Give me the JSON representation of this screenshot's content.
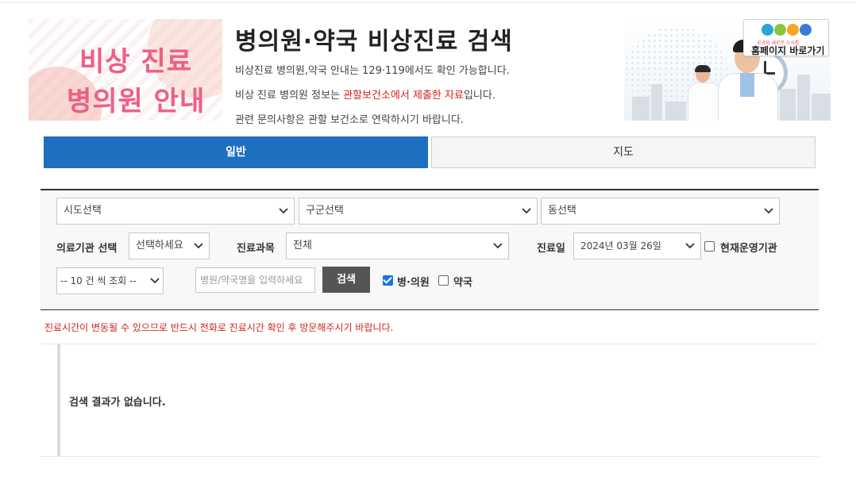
{
  "header": {
    "banner_left": {
      "line1": "비상 진료",
      "line2": "병의원 안내"
    },
    "title": "병의원·약국 비상진료 검색",
    "info1": "비상진료 병의원,약국 안내는 129·119에서도 확인 가능합니다.",
    "info2_pre": "비상 진료 병의원 정보는 ",
    "info2_red": "관할보건소에서 제출한 자료",
    "info2_post": "입니다.",
    "info3": "관련 문의사항은 관할 보건소로 연락하시기 바랍니다.",
    "home_button": {
      "tagline": "공공의 새로운 소식통",
      "label": "홈페이지 바로가기"
    }
  },
  "tabs": [
    {
      "label": "일반",
      "active": true
    },
    {
      "label": "지도",
      "active": false
    }
  ],
  "search": {
    "sido": "시도선택",
    "gugun": "구군선택",
    "dong": "동선택",
    "institution_label": "의료기관 선택",
    "institution_value": "선택하세요",
    "subject_label": "진료과목",
    "subject_value": "전체",
    "date_label": "진료일",
    "date_value": "2024년 03월 26일",
    "open_now_label": "현재운영기관",
    "open_now_checked": false,
    "page_size": "-- 10 건 씩 조회 --",
    "name_placeholder": "병원/약국명을 입력하세요",
    "search_button": "검색",
    "hospital_label": "병·의원",
    "hospital_checked": true,
    "pharmacy_label": "약국",
    "pharmacy_checked": false
  },
  "notice": "진료시간이 변동될 수 있으므로 반드시 전화로 진료시간 확인 후 방문해주시기 바랍니다.",
  "result": {
    "message": "검색 결과가 없습니다."
  },
  "colors": {
    "tab_active": "#1e6fbd",
    "notice_red": "#d0251a",
    "banner_pink": "#ee5f86",
    "search_button": "#555555",
    "checkbox_blue": "#1a73e8"
  }
}
